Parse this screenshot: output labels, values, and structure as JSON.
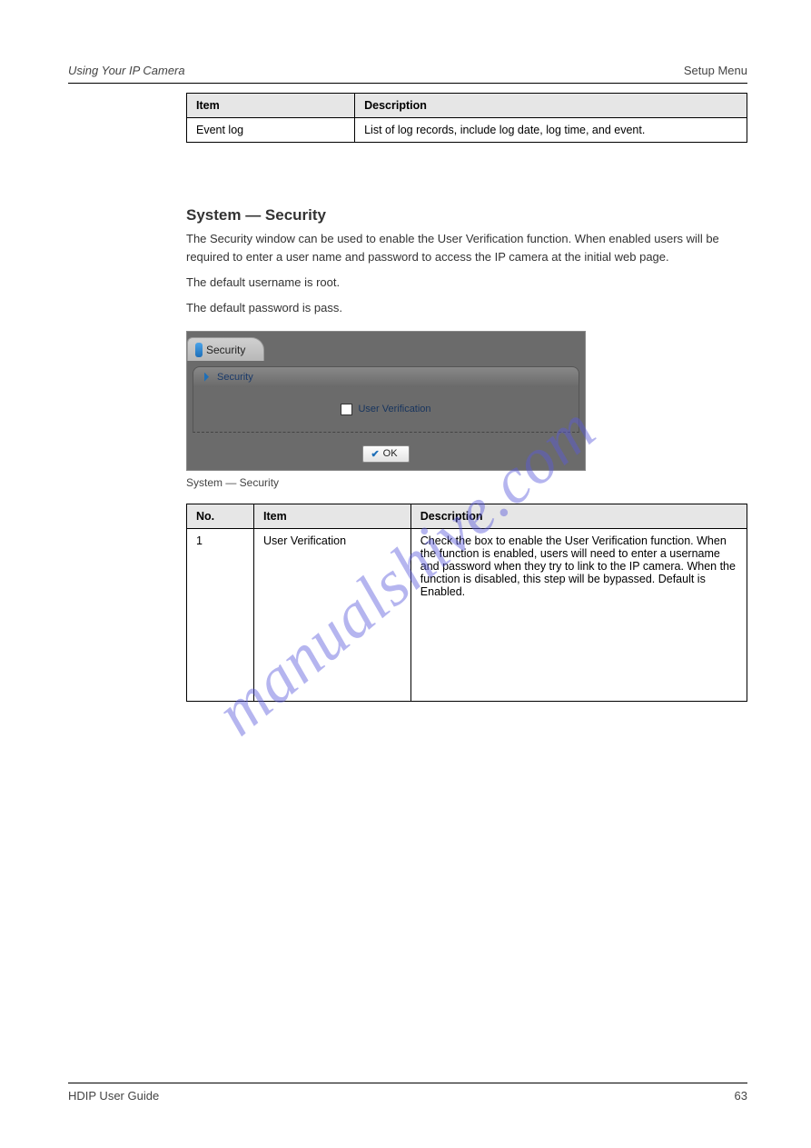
{
  "header": {
    "left": "Using Your IP Camera",
    "right": "Setup Menu"
  },
  "table1": {
    "headers": [
      "Item",
      "Description"
    ],
    "rows": [
      [
        "Event log",
        "List of log records, include log date, log time, and event."
      ]
    ]
  },
  "section": {
    "title": "System — Security",
    "p1": "The Security window can be used to enable the User Verification function. When enabled users will be required to enter a user name and password to access the IP camera at the initial web page.",
    "p2": "The default username is root.",
    "p3": "The default password is pass."
  },
  "ui": {
    "tab_label": "Security",
    "panel_header": "Security",
    "checkbox_label": "User Verification",
    "ok_label": "OK"
  },
  "caption": "System — Security",
  "table2": {
    "headers": [
      "No.",
      "Item",
      "Description"
    ],
    "rows": [
      [
        "1",
        "User Verification",
        "Check the box to enable the User Verification function. When the function is enabled, users will need to enter a username and password when they try to link to the IP camera. When the function is disabled, this step will be bypassed. Default is Enabled."
      ]
    ]
  },
  "footer": {
    "left": "HDIP User Guide",
    "right": "63"
  },
  "watermark": "manualshive.com"
}
